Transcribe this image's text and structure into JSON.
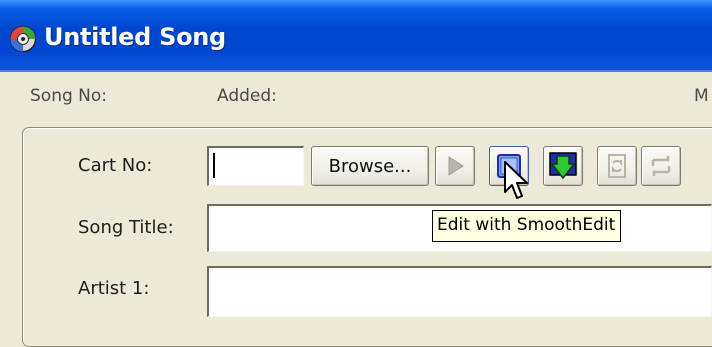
{
  "window": {
    "title": "Untitled Song",
    "icon": "cd-disc-icon"
  },
  "info_row": {
    "song_no_label": "Song No:",
    "added_label": "Added:",
    "truncated_label": "M"
  },
  "form": {
    "cart_no": {
      "label": "Cart No:",
      "value": "",
      "cursor_visible": true
    },
    "browse_button_label": "Browse...",
    "song_title": {
      "label": "Song Title:",
      "value": ""
    },
    "artist_1": {
      "label": "Artist 1:",
      "value": ""
    }
  },
  "toolbar": {
    "buttons": [
      {
        "icon": "play-icon",
        "enabled": false
      },
      {
        "icon": "edit-smoothedit-icon",
        "enabled": true,
        "hovered": true
      },
      {
        "icon": "download-arrow-icon",
        "enabled": true
      },
      {
        "icon": "refresh-icon",
        "enabled": false
      },
      {
        "icon": "swap-icon",
        "enabled": false
      }
    ]
  },
  "tooltip": {
    "text": "Edit with SmoothEdit"
  },
  "colors": {
    "titlebar": "#0046CE",
    "window_bg": "#ECE9D8",
    "tooltip_bg": "#FFFFE1",
    "download_green": "#2EC92E"
  }
}
